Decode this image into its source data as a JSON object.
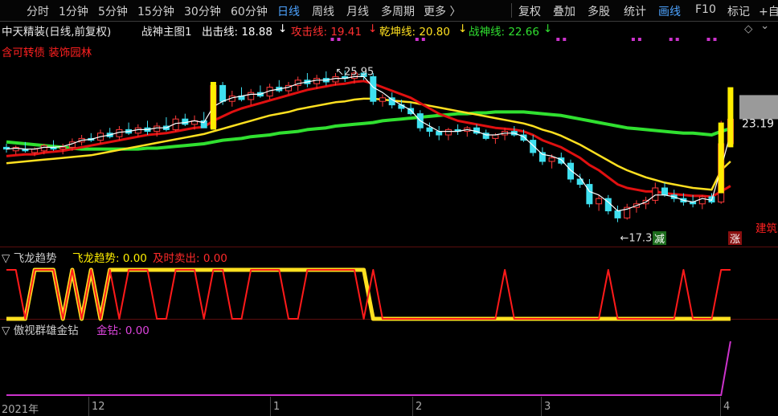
{
  "toolbar": {
    "periods": [
      "分时",
      "1分钟",
      "5分钟",
      "15分钟",
      "30分钟",
      "60分钟",
      "日线",
      "周线",
      "月线",
      "多周期",
      "更多 〉"
    ],
    "active_period": "日线",
    "right_buttons": [
      "复权",
      "叠加",
      "多股",
      "统计",
      "画线",
      "F10",
      "标记",
      "+自"
    ],
    "active_right": "画线"
  },
  "main_title": {
    "stock_name": "中天精装(日线,前复权)",
    "indicator_name": "战神主图1",
    "chuji_label": "出击线: 18.88",
    "gongji_label": "攻击线: 19.41",
    "qiankun_label": "乾坤线: 20.80",
    "zhanshen_label": "战神线: 22.66",
    "tag_left": "含可转债 装饰园林",
    "tag_right": "建筑",
    "diamond": "◇",
    "arrow": "⌄"
  },
  "colors": {
    "up": "#ff3a3a",
    "down": "#3fe0f0",
    "chuji": "#ffffff",
    "gongji": "#e01010",
    "qiankun": "#ffe020",
    "zhanshen": "#30e030",
    "magenta": "#cc33cc",
    "yellow_box": "#ffee00"
  },
  "annotations": {
    "high": "25.95",
    "low": "17.36",
    "last_price": "23.19",
    "jian": "减",
    "zhang": "涨"
  },
  "indicator1": {
    "title": "飞龙趋势",
    "label_a": "飞龙趋势: 0.00",
    "label_b": "及时卖出: 0.00"
  },
  "indicator2": {
    "title": "傲视群雄金钻",
    "label": "金钻: 0.00"
  },
  "x_axis": {
    "labels": [
      "2021年",
      "12",
      "1",
      "2",
      "3",
      "4"
    ]
  },
  "chart_data": {
    "type": "candlestick",
    "ohlc": [
      [
        21.6,
        21.8,
        21.3,
        21.5
      ],
      [
        21.4,
        21.7,
        21.2,
        21.6
      ],
      [
        21.5,
        21.9,
        21.3,
        21.4
      ],
      [
        21.3,
        21.6,
        21.1,
        21.5
      ],
      [
        21.4,
        21.8,
        21.2,
        21.7
      ],
      [
        21.6,
        22.0,
        21.4,
        21.5
      ],
      [
        21.5,
        21.8,
        21.2,
        21.6
      ],
      [
        21.6,
        22.1,
        21.4,
        21.9
      ],
      [
        21.9,
        22.3,
        21.7,
        22.1
      ],
      [
        22.1,
        22.4,
        21.9,
        22.0
      ],
      [
        22.0,
        22.6,
        21.8,
        22.4
      ],
      [
        22.4,
        22.7,
        22.1,
        22.2
      ],
      [
        22.2,
        22.8,
        22.0,
        22.6
      ],
      [
        22.6,
        23.0,
        22.3,
        22.4
      ],
      [
        22.4,
        22.9,
        22.2,
        22.7
      ],
      [
        22.7,
        23.1,
        22.3,
        22.5
      ],
      [
        22.5,
        23.0,
        22.2,
        22.8
      ],
      [
        22.8,
        23.3,
        22.5,
        22.6
      ],
      [
        22.6,
        23.4,
        22.5,
        23.2
      ],
      [
        23.2,
        23.5,
        22.8,
        22.9
      ],
      [
        22.9,
        23.4,
        22.6,
        23.1
      ],
      [
        23.1,
        23.6,
        22.8,
        22.7
      ],
      [
        22.7,
        25.3,
        22.6,
        25.1
      ],
      [
        25.1,
        25.3,
        24.0,
        24.2
      ],
      [
        24.2,
        24.8,
        23.9,
        24.5
      ],
      [
        24.5,
        25.0,
        24.2,
        24.3
      ],
      [
        24.3,
        24.9,
        24.0,
        24.7
      ],
      [
        24.7,
        25.1,
        24.4,
        24.5
      ],
      [
        24.5,
        25.2,
        24.3,
        25.0
      ],
      [
        25.0,
        25.4,
        24.7,
        24.8
      ],
      [
        24.8,
        25.3,
        24.6,
        25.1
      ],
      [
        25.1,
        25.6,
        24.8,
        25.4
      ],
      [
        25.4,
        25.8,
        25.0,
        25.2
      ],
      [
        25.2,
        25.7,
        24.9,
        25.5
      ],
      [
        25.5,
        25.9,
        25.1,
        25.3
      ],
      [
        25.3,
        25.8,
        25.1,
        25.6
      ],
      [
        25.6,
        25.95,
        25.3,
        25.5
      ],
      [
        25.5,
        25.9,
        25.2,
        25.8
      ],
      [
        25.8,
        25.9,
        25.4,
        25.6
      ],
      [
        25.6,
        25.8,
        24.0,
        24.2
      ],
      [
        24.2,
        24.6,
        23.9,
        24.4
      ],
      [
        24.4,
        24.7,
        23.8,
        24.0
      ],
      [
        24.0,
        24.3,
        23.6,
        23.8
      ],
      [
        23.8,
        24.1,
        23.4,
        23.5
      ],
      [
        23.5,
        23.7,
        22.5,
        22.7
      ],
      [
        22.7,
        23.0,
        22.2,
        22.5
      ],
      [
        22.5,
        22.8,
        22.0,
        22.3
      ],
      [
        22.3,
        22.7,
        22.0,
        22.6
      ],
      [
        22.6,
        22.9,
        22.3,
        22.5
      ],
      [
        22.5,
        22.8,
        22.2,
        22.7
      ],
      [
        22.7,
        22.9,
        22.3,
        22.4
      ],
      [
        22.4,
        22.6,
        22.0,
        22.1
      ],
      [
        22.1,
        22.4,
        21.8,
        22.3
      ],
      [
        22.3,
        22.7,
        22.0,
        22.5
      ],
      [
        22.5,
        22.8,
        22.2,
        22.3
      ],
      [
        22.3,
        22.6,
        21.9,
        22.0
      ],
      [
        22.0,
        22.3,
        21.1,
        21.3
      ],
      [
        21.3,
        21.6,
        20.6,
        20.8
      ],
      [
        20.8,
        21.2,
        20.4,
        21.0
      ],
      [
        21.0,
        21.3,
        20.6,
        20.7
      ],
      [
        20.7,
        20.9,
        19.6,
        19.8
      ],
      [
        19.8,
        20.1,
        19.3,
        19.5
      ],
      [
        19.5,
        19.8,
        18.2,
        18.4
      ],
      [
        18.4,
        18.9,
        18.0,
        18.7
      ],
      [
        18.7,
        18.9,
        17.8,
        18.0
      ],
      [
        18.0,
        18.3,
        17.36,
        17.6
      ],
      [
        17.6,
        18.4,
        17.5,
        18.2
      ],
      [
        18.2,
        18.6,
        17.9,
        18.4
      ],
      [
        18.4,
        18.8,
        18.1,
        18.6
      ],
      [
        18.6,
        19.6,
        18.4,
        19.3
      ],
      [
        19.3,
        19.6,
        18.8,
        18.9
      ],
      [
        18.9,
        19.2,
        18.5,
        18.7
      ],
      [
        18.7,
        19.0,
        18.3,
        18.5
      ],
      [
        18.5,
        18.9,
        18.2,
        18.4
      ],
      [
        18.4,
        18.9,
        18.1,
        18.8
      ],
      [
        18.8,
        19.0,
        18.4,
        18.5
      ],
      [
        18.5,
        23.1,
        18.4,
        21.8
      ],
      [
        21.8,
        23.2,
        21.6,
        23.19
      ]
    ],
    "chuji": [
      21.5,
      21.55,
      21.5,
      21.5,
      21.6,
      21.6,
      21.65,
      21.8,
      22.0,
      22.05,
      22.2,
      22.3,
      22.45,
      22.5,
      22.6,
      22.6,
      22.7,
      22.7,
      22.95,
      23.0,
      23.1,
      23.0,
      23.9,
      24.2,
      24.4,
      24.5,
      24.6,
      24.6,
      24.8,
      24.9,
      25.0,
      25.2,
      25.3,
      25.4,
      25.4,
      25.5,
      25.5,
      25.6,
      25.6,
      25.0,
      24.7,
      24.3,
      24.0,
      23.7,
      23.1,
      22.8,
      22.5,
      22.5,
      22.5,
      22.6,
      22.5,
      22.3,
      22.3,
      22.4,
      22.4,
      22.2,
      21.7,
      21.2,
      21.1,
      20.9,
      20.3,
      19.9,
      19.1,
      18.9,
      18.5,
      18.0,
      18.1,
      18.3,
      18.5,
      18.9,
      18.9,
      18.8,
      18.6,
      18.5,
      18.7,
      18.6,
      20.4,
      22.4
    ],
    "gongji": [
      21.1,
      21.15,
      21.2,
      21.2,
      21.3,
      21.35,
      21.4,
      21.5,
      21.6,
      21.7,
      21.8,
      21.9,
      22.0,
      22.1,
      22.2,
      22.3,
      22.35,
      22.4,
      22.5,
      22.6,
      22.7,
      22.75,
      23.1,
      23.35,
      23.6,
      23.8,
      23.95,
      24.1,
      24.25,
      24.4,
      24.55,
      24.7,
      24.85,
      24.95,
      25.05,
      25.15,
      25.2,
      25.3,
      25.35,
      25.2,
      25.0,
      24.8,
      24.6,
      24.4,
      24.1,
      23.8,
      23.5,
      23.3,
      23.1,
      23.0,
      22.9,
      22.8,
      22.7,
      22.65,
      22.6,
      22.5,
      22.3,
      22.0,
      21.8,
      21.6,
      21.3,
      21.0,
      20.6,
      20.3,
      19.9,
      19.5,
      19.3,
      19.2,
      19.1,
      19.1,
      19.0,
      18.95,
      18.9,
      18.85,
      18.85,
      18.8,
      19.1,
      19.41
    ],
    "qiankun": [
      20.7,
      20.75,
      20.8,
      20.85,
      20.9,
      20.95,
      21.0,
      21.05,
      21.1,
      21.15,
      21.25,
      21.35,
      21.45,
      21.55,
      21.65,
      21.75,
      21.85,
      21.95,
      22.05,
      22.15,
      22.25,
      22.35,
      22.5,
      22.65,
      22.8,
      22.95,
      23.1,
      23.25,
      23.4,
      23.5,
      23.6,
      23.75,
      23.85,
      23.95,
      24.05,
      24.15,
      24.2,
      24.3,
      24.35,
      24.35,
      24.3,
      24.25,
      24.2,
      24.15,
      24.05,
      23.95,
      23.85,
      23.75,
      23.65,
      23.55,
      23.45,
      23.35,
      23.25,
      23.15,
      23.05,
      22.95,
      22.8,
      22.6,
      22.45,
      22.25,
      22.0,
      21.75,
      21.45,
      21.15,
      20.85,
      20.55,
      20.3,
      20.1,
      19.9,
      19.75,
      19.6,
      19.5,
      19.4,
      19.3,
      19.25,
      19.2,
      20.3,
      20.8
    ],
    "zhanshen": [
      21.9,
      21.85,
      21.8,
      21.75,
      21.7,
      21.65,
      21.6,
      21.55,
      21.5,
      21.5,
      21.5,
      21.5,
      21.5,
      21.5,
      21.5,
      21.55,
      21.55,
      21.6,
      21.65,
      21.7,
      21.75,
      21.8,
      21.9,
      22.0,
      22.05,
      22.1,
      22.2,
      22.25,
      22.3,
      22.4,
      22.45,
      22.5,
      22.6,
      22.65,
      22.7,
      22.8,
      22.85,
      22.9,
      22.95,
      23.0,
      23.1,
      23.15,
      23.2,
      23.25,
      23.3,
      23.35,
      23.4,
      23.45,
      23.5,
      23.5,
      23.55,
      23.55,
      23.6,
      23.6,
      23.6,
      23.6,
      23.55,
      23.5,
      23.45,
      23.4,
      23.3,
      23.2,
      23.1,
      23.0,
      22.9,
      22.8,
      22.7,
      22.65,
      22.6,
      22.55,
      22.5,
      22.45,
      22.4,
      22.4,
      22.35,
      22.3,
      22.5,
      22.66
    ],
    "yellow_bars": [
      {
        "index": 22,
        "low": 22.6,
        "high": 25.3
      },
      {
        "index": 76,
        "low": 19.0,
        "high": 23.0
      },
      {
        "index": 77,
        "low": 21.6,
        "high": 25.0
      }
    ],
    "feilong": [
      0,
      0,
      0,
      1,
      1,
      1,
      0,
      1,
      0,
      1,
      0,
      1,
      1,
      1,
      1,
      1,
      1,
      1,
      1,
      1,
      1,
      1,
      1,
      1,
      1,
      1,
      1,
      1,
      1,
      1,
      1,
      1,
      1,
      1,
      1,
      1,
      1,
      1,
      1,
      0,
      0,
      0,
      0,
      0,
      0,
      0,
      0,
      0,
      0,
      0,
      0,
      0,
      0,
      0,
      0,
      0,
      0,
      0,
      0,
      0,
      0,
      0,
      0,
      0,
      0,
      0,
      0,
      0,
      0,
      0,
      0,
      0,
      0,
      0,
      0,
      0,
      0,
      0
    ],
    "jishi": [
      1,
      1,
      0,
      1,
      1,
      1,
      0,
      1,
      0,
      1,
      0,
      1,
      0,
      1,
      1,
      1,
      0,
      0,
      1,
      1,
      1,
      0,
      1,
      1,
      0,
      0,
      1,
      1,
      1,
      1,
      0,
      0,
      1,
      1,
      1,
      1,
      1,
      1,
      0,
      1,
      0,
      0,
      0,
      0,
      0,
      0,
      0,
      0,
      0,
      0,
      0,
      0,
      0,
      1,
      0,
      0,
      0,
      0,
      0,
      0,
      0,
      0,
      0,
      0,
      1,
      0,
      0,
      0,
      0,
      0,
      0,
      0,
      1,
      0,
      0,
      0,
      1,
      1
    ],
    "jinzuan": [
      0,
      0,
      0,
      0,
      0,
      0,
      0,
      0,
      0,
      0,
      0,
      0,
      0,
      0,
      0,
      0,
      0,
      0,
      0,
      0,
      0,
      0,
      0,
      0,
      0,
      0,
      0,
      0,
      0,
      0,
      0,
      0,
      0,
      0,
      0,
      0,
      0,
      0,
      0,
      0,
      0,
      0,
      0,
      0,
      0,
      0,
      0,
      0,
      0,
      0,
      0,
      0,
      0,
      0,
      0,
      0,
      0,
      0,
      0,
      0,
      0,
      0,
      0,
      0,
      0,
      0,
      0,
      0,
      0,
      0,
      0,
      0,
      0,
      0,
      0,
      0,
      0,
      1
    ],
    "x_labels": [
      "2021年",
      "12",
      "1",
      "2",
      "3",
      "4"
    ],
    "ylim": [
      16.3,
      27.8
    ]
  }
}
